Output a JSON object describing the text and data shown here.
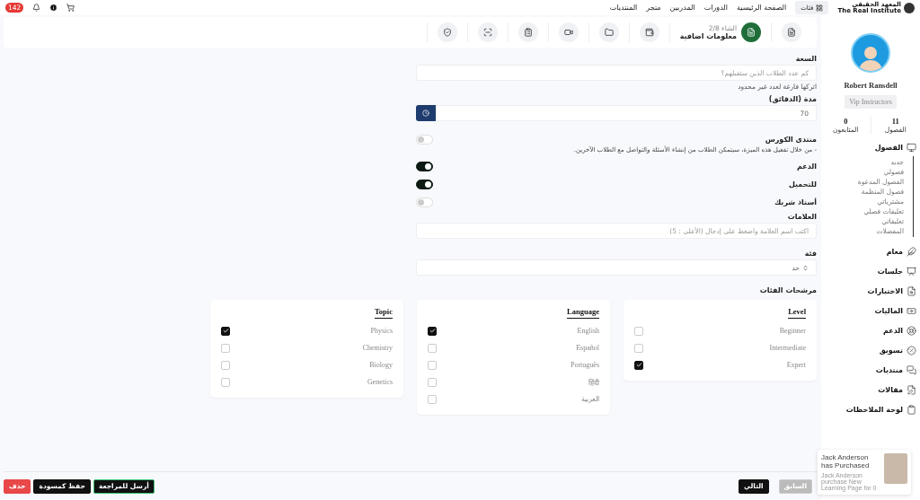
{
  "header": {
    "logo": {
      "title": "المعهد الحقيقي",
      "subtitle": "The Real Institute"
    },
    "categories_button": "فئات",
    "nav": [
      "الصفحة الرئيسية",
      "الدورات",
      "المدربين",
      "متجر",
      "المنتديات"
    ],
    "notifications_badge": "142"
  },
  "steps": [
    {
      "selected": false
    },
    {
      "selected": true,
      "counter": "الشاء 2/8",
      "title": "معلومات اضافية"
    },
    {
      "selected": false
    },
    {
      "selected": false
    },
    {
      "selected": false
    },
    {
      "selected": false
    },
    {
      "selected": false
    },
    {
      "selected": false
    }
  ],
  "sidebar": {
    "name": "Robert Ransdell",
    "role": "Vip Instructors",
    "stats": [
      {
        "value": "11",
        "label": "الفصول"
      },
      {
        "value": "0",
        "label": "المتابعون"
      }
    ],
    "menu": [
      {
        "label": "الفصول",
        "expanded": true,
        "children": [
          {
            "label": "جديد"
          },
          {
            "label": "فصولي"
          },
          {
            "label": "الفصول المدعوة"
          },
          {
            "label": "فصول المنظمة"
          },
          {
            "label": "مشترياتي"
          },
          {
            "label": "تعليقات فصلي"
          },
          {
            "label": "تعليقاتي"
          },
          {
            "label": "المفضلات"
          }
        ]
      },
      {
        "label": "معام"
      },
      {
        "label": "جلسات"
      },
      {
        "label": "الاختبارات"
      },
      {
        "label": "الماليات"
      },
      {
        "label": "الدعم"
      },
      {
        "label": "تسويق"
      },
      {
        "label": "منتديات"
      },
      {
        "label": "مقالات"
      },
      {
        "label": "لوحة الملاحظات"
      }
    ]
  },
  "form": {
    "capacity": {
      "label": "السعة",
      "placeholder": "كم عدد الطلاب الذين ستقبلهم؟",
      "hint": "اتركها فارغة لعدد غير محدود"
    },
    "duration": {
      "label": "مدة (الدقائق)",
      "value": "70"
    },
    "toggles": [
      {
        "label": "منتدى الكورس",
        "on": false,
        "description": "- من خلال تفعيل هذه الميزة، سيتمكن الطلاب من إنشاء الأسئلة والتواصل مع الطلاب الآخرين."
      },
      {
        "label": "الدعم",
        "on": true
      },
      {
        "label": "للتحميل",
        "on": true
      },
      {
        "label": "أستاذ شريك",
        "on": false
      }
    ],
    "tags": {
      "label": "العلامات",
      "placeholder": "اكتب اسم العلامة واضغط على إدخال (الأعلى : 5)"
    },
    "category": {
      "label": "فئة",
      "value": "حد"
    },
    "filters_label": "مرشحات الفئات",
    "filters": [
      {
        "title": "Level",
        "options": [
          {
            "label": "Beginner",
            "checked": false
          },
          {
            "label": "Intermediate",
            "checked": false
          },
          {
            "label": "Expert",
            "checked": true
          }
        ]
      },
      {
        "title": "Language",
        "options": [
          {
            "label": "English",
            "checked": true
          },
          {
            "label": "Español",
            "checked": false
          },
          {
            "label": "Português",
            "checked": false
          },
          {
            "label": "हिंदी",
            "checked": false
          },
          {
            "label": "العربية",
            "checked": false
          }
        ]
      },
      {
        "title": "Topic",
        "options": [
          {
            "label": "Physics",
            "checked": true
          },
          {
            "label": "Chemistry",
            "checked": false
          },
          {
            "label": "Biology",
            "checked": false
          },
          {
            "label": "Genetics",
            "checked": false
          }
        ]
      }
    ]
  },
  "footer": {
    "previous": "السابق",
    "next": "التالي",
    "actions": [
      {
        "kind": "primary",
        "label": "أرسل للمراجعة"
      },
      {
        "kind": "dark",
        "label": "حفظ كمسودة"
      },
      {
        "kind": "danger",
        "label": "حذف"
      }
    ]
  },
  "toast": {
    "title": "Jack Anderson has Purchased",
    "body": "Jack Anderson purchase New Learning Page for 0"
  }
}
